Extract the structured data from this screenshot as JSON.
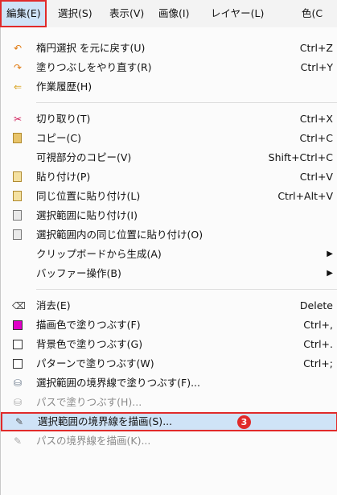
{
  "menubar": {
    "items": [
      "編集(E)",
      "選択(S)",
      "表示(V)",
      "画像(I)",
      "レイヤー(L)",
      "色(C"
    ]
  },
  "menu": {
    "items": [
      {
        "label": "楕円選択 を元に戻す(U)",
        "shortcut": "Ctrl+Z",
        "icon": "undo-icon"
      },
      {
        "label": "塗りつぶしをやり直す(R)",
        "shortcut": "Ctrl+Y",
        "icon": "redo-icon"
      },
      {
        "label": "作業履歴(H)",
        "shortcut": "",
        "icon": "history-icon"
      },
      {
        "label": "切り取り(T)",
        "shortcut": "Ctrl+X",
        "icon": "scissors-icon"
      },
      {
        "label": "コピー(C)",
        "shortcut": "Ctrl+C",
        "icon": "copy-icon"
      },
      {
        "label": "可視部分のコピー(V)",
        "shortcut": "Shift+Ctrl+C",
        "icon": ""
      },
      {
        "label": "貼り付け(P)",
        "shortcut": "Ctrl+V",
        "icon": "paste-icon"
      },
      {
        "label": "同じ位置に貼り付け(L)",
        "shortcut": "Ctrl+Alt+V",
        "icon": "paste-in-place-icon"
      },
      {
        "label": "選択範囲に貼り付け(I)",
        "shortcut": "",
        "icon": "paste-into-icon"
      },
      {
        "label": "選択範囲内の同じ位置に貼り付け(O)",
        "shortcut": "",
        "icon": "paste-into-in-place-icon"
      },
      {
        "label": "クリップボードから生成(A)",
        "shortcut": "",
        "icon": "",
        "submenu": true
      },
      {
        "label": "バッファー操作(B)",
        "shortcut": "",
        "icon": "",
        "submenu": true
      },
      {
        "label": "消去(E)",
        "shortcut": "Delete",
        "icon": "clear-icon"
      },
      {
        "label": "描画色で塗りつぶす(F)",
        "shortcut": "Ctrl+,",
        "icon": "fg-color-swatch-icon"
      },
      {
        "label": "背景色で塗りつぶす(G)",
        "shortcut": "Ctrl+.",
        "icon": "bg-color-swatch-icon"
      },
      {
        "label": "パターンで塗りつぶす(W)",
        "shortcut": "Ctrl+;",
        "icon": "pattern-swatch-icon"
      },
      {
        "label": "選択範囲の境界線で塗りつぶす(F)...",
        "shortcut": "",
        "icon": "fill-selection-outline-icon"
      },
      {
        "label": "パスで塗りつぶす(H)...",
        "shortcut": "",
        "icon": "fill-path-icon",
        "disabled": true
      },
      {
        "label": "選択範囲の境界線を描画(S)...",
        "shortcut": "",
        "icon": "stroke-selection-icon",
        "highlighted": true,
        "badge": "3"
      },
      {
        "label": "パスの境界線を描画(K)...",
        "shortcut": "",
        "icon": "stroke-path-icon",
        "disabled": true
      }
    ]
  },
  "colors": {
    "fg_swatch": "#e000c8",
    "highlight": "#cfe3f7",
    "annotation": "#e12a2a"
  }
}
